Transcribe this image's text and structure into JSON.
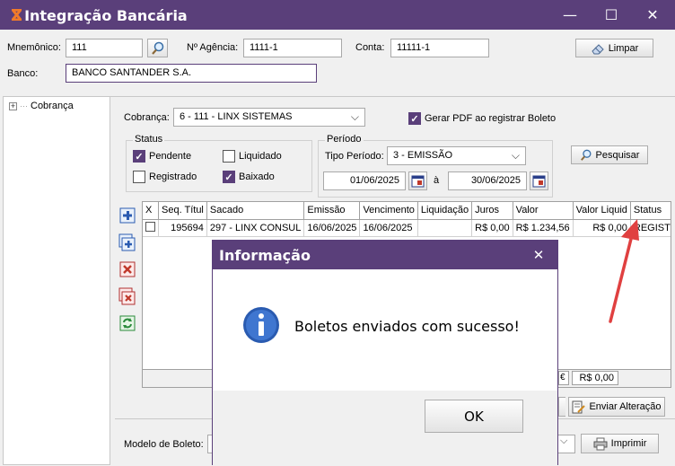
{
  "window": {
    "title": "Integração Bancária",
    "minimize": "—",
    "maximize": "☐",
    "close": "✕"
  },
  "top_form": {
    "mnemonico_label": "Mnemônico:",
    "mnemonico_value": "111",
    "agencia_label": "Nº Agência:",
    "agencia_value": "1111-1",
    "conta_label": "Conta:",
    "conta_value": "11111-1",
    "limpar_label": "Limpar",
    "banco_label": "Banco:",
    "banco_value": "BANCO SANTANDER S.A."
  },
  "tree": {
    "expander": "+",
    "root_label": "Cobrança"
  },
  "filters": {
    "cobranca_label": "Cobrança:",
    "cobranca_value": "6 - 111 - LINX SISTEMAS",
    "gerar_pdf_label": "Gerar PDF ao registrar Boleto",
    "gerar_pdf_checked": true,
    "status_group_label": "Status",
    "status": [
      {
        "label": "Pendente",
        "checked": true
      },
      {
        "label": "Liquidado",
        "checked": false
      },
      {
        "label": "Registrado",
        "checked": false
      },
      {
        "label": "Baixado",
        "checked": true
      }
    ],
    "periodo_group_label": "Período",
    "tipo_periodo_label": "Tipo Período:",
    "tipo_periodo_value": "3 - EMISSÃO",
    "data_inicio": "01/06/2025",
    "data_ate_label": "à",
    "data_fim": "30/06/2025",
    "pesquisar_label": "Pesquisar"
  },
  "grid": {
    "columns": [
      "X",
      "Seq. Títul",
      "Sacado",
      "Emissão",
      "Vencimento",
      "Liquidação",
      "Juros",
      "Valor",
      "Valor Liquid",
      "Status"
    ],
    "rows": [
      {
        "checked": false,
        "seq": "195694",
        "sacado": "297 - LINX CONSUL",
        "emissao": "16/06/2025",
        "vencimento": "16/06/2025",
        "liquidacao": "",
        "juros": "R$ 0,00",
        "valor": "R$ 1.234,56",
        "valor_liquido": "R$ 0,00",
        "status": "REGISTRAD"
      }
    ],
    "footer_partial": "€",
    "footer_total": "R$ 0,00"
  },
  "actions": {
    "enviar_alteracao_label": "Enviar Alteração",
    "modelo_boleto_label": "Modelo de Boleto:",
    "imprimir_label": "Imprimir"
  },
  "side_icons": [
    "add-icon",
    "add-multiple-icon",
    "delete-icon",
    "delete-multiple-icon",
    "refresh-icon"
  ],
  "dialog": {
    "title": "Informação",
    "close": "✕",
    "message": "Boletos enviados com sucesso!",
    "ok_label": "OK"
  },
  "colors": {
    "titlebar": "#5a3f7a",
    "annotation_arrow": "#e04040",
    "info_icon": "#2a5bb0"
  }
}
